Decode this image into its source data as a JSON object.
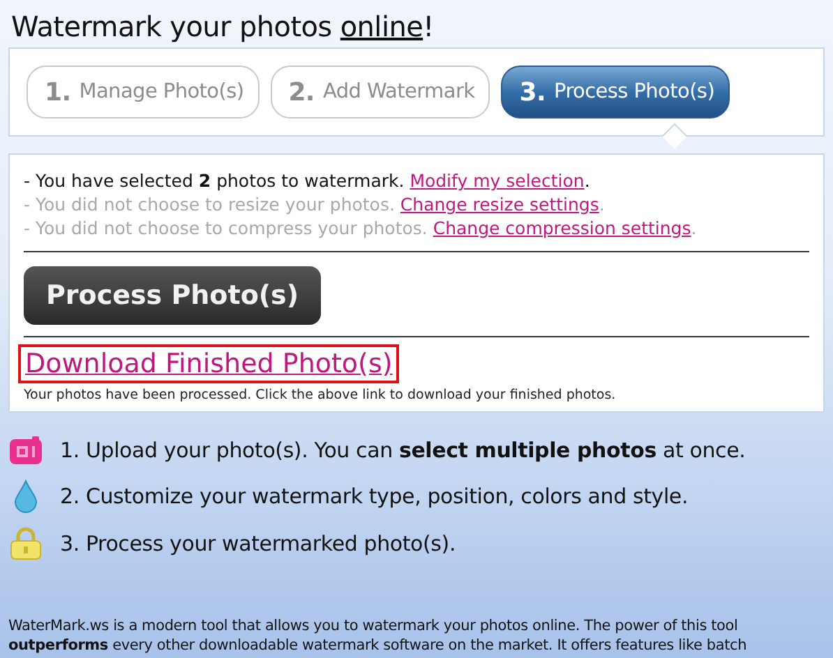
{
  "heading": {
    "text": "Watermark your photos ",
    "link": "online",
    "end": "!"
  },
  "tabs": [
    {
      "number": "1.",
      "label": "Manage Photo(s)",
      "selected": false
    },
    {
      "number": "2.",
      "label": "Add Watermark",
      "selected": false
    },
    {
      "number": "3.",
      "label": "Process Photo(s)",
      "selected": true
    }
  ],
  "summary": [
    {
      "kind": "normal",
      "text": "- You have selected **2** photos to watermark. ",
      "link": "Modify my selection",
      "end": "."
    },
    {
      "kind": "muted",
      "text": "- You did not choose to resize your photos. ",
      "link": "Change resize settings",
      "end": "."
    },
    {
      "kind": "muted",
      "text": "- You did not choose to compress your photos. ",
      "link": "Change compression settings",
      "end": "."
    }
  ],
  "process_button": "Process Photo(s)",
  "download_link": "Download Finished Photo(s)",
  "download_note": "Your photos have been processed. Click the above link to download your finished photos.",
  "steps": [
    {
      "kind": "camera",
      "text": "1. Upload your photo(s). You can **select multiple photos** at once."
    },
    {
      "kind": "drop",
      "text": "2. Customize your watermark type, position, colors and style."
    },
    {
      "kind": "lock",
      "text": "3. Process your watermarked photo(s)."
    }
  ],
  "about": "WaterMark.ws is a modern tool that allows you to watermark your photos online. The power of this tool **outperforms** every other downloadable watermark software on the market. It offers features like batch"
}
